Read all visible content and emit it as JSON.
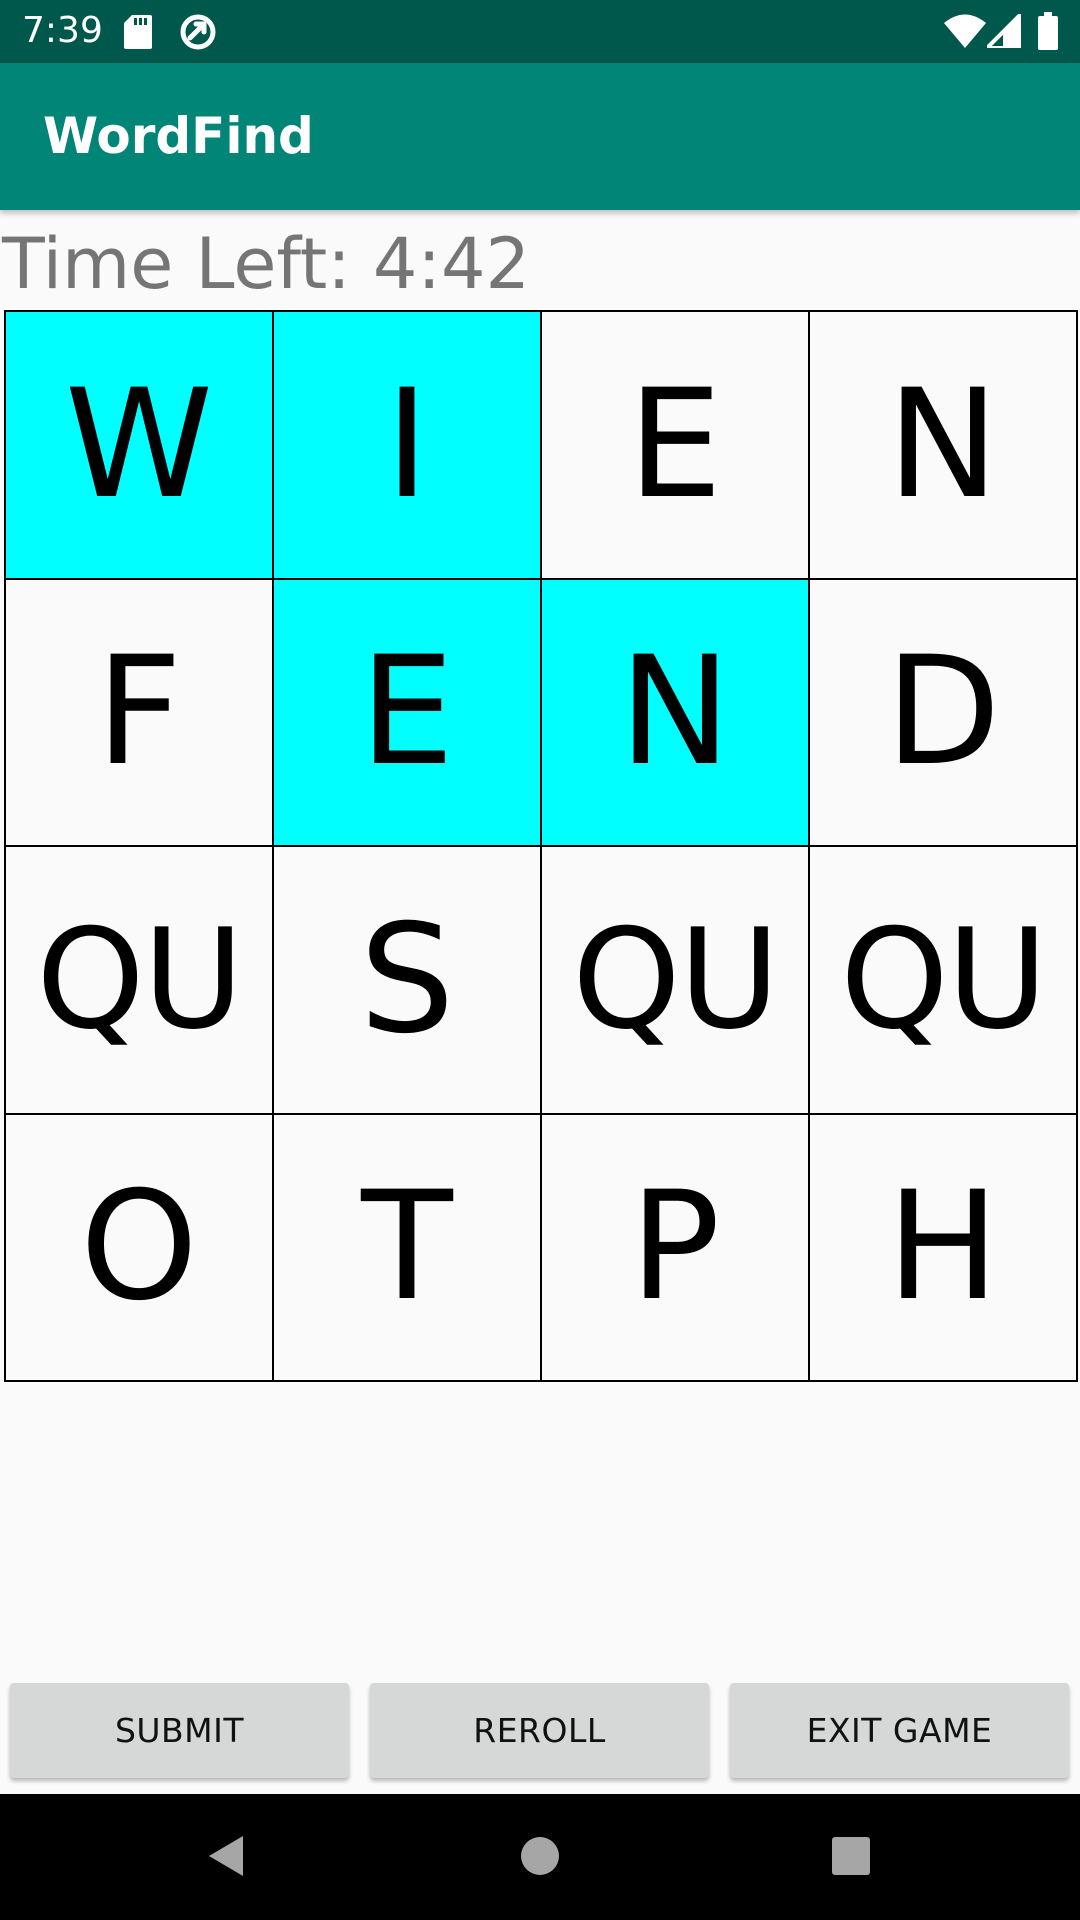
{
  "status_bar": {
    "time": "7:39",
    "icons": [
      "sd-card-icon",
      "sync-icon",
      "wifi-icon",
      "cell-signal-icon",
      "battery-icon"
    ]
  },
  "app_bar": {
    "title": "WordFind"
  },
  "timer": {
    "label": "Time Left:",
    "value": "4:42"
  },
  "board": {
    "rows": [
      [
        {
          "letter": "W",
          "selected": true
        },
        {
          "letter": "I",
          "selected": true
        },
        {
          "letter": "E",
          "selected": false
        },
        {
          "letter": "N",
          "selected": false
        }
      ],
      [
        {
          "letter": "F",
          "selected": false
        },
        {
          "letter": "E",
          "selected": true
        },
        {
          "letter": "N",
          "selected": true
        },
        {
          "letter": "D",
          "selected": false
        }
      ],
      [
        {
          "letter": "QU",
          "selected": false
        },
        {
          "letter": "S",
          "selected": false
        },
        {
          "letter": "QU",
          "selected": false
        },
        {
          "letter": "QU",
          "selected": false
        }
      ],
      [
        {
          "letter": "O",
          "selected": false
        },
        {
          "letter": "T",
          "selected": false
        },
        {
          "letter": "P",
          "selected": false
        },
        {
          "letter": "H",
          "selected": false
        }
      ]
    ]
  },
  "buttons": {
    "submit": "SUBMIT",
    "reroll": "REROLL",
    "exit": "EXIT GAME"
  },
  "nav_bar": {
    "icons": [
      "back-icon",
      "home-icon",
      "recents-icon"
    ]
  },
  "colors": {
    "status_bar": "#00574b",
    "app_bar": "#008577",
    "selected_cell": "#00ffff",
    "cell_bg": "#fafafa",
    "button_bg": "#d6d7d7",
    "timer_text": "#757575"
  }
}
